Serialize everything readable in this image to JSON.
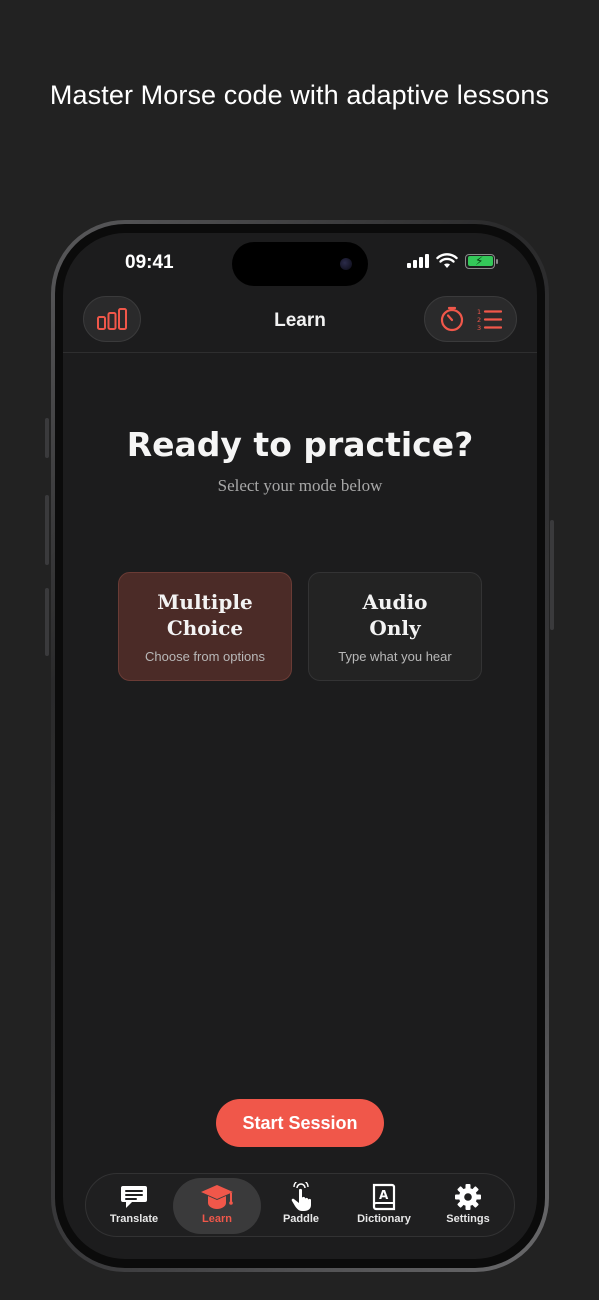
{
  "tagline": "Master Morse code with adaptive lessons",
  "status_bar": {
    "time": "09:41"
  },
  "header": {
    "title": "Learn"
  },
  "main": {
    "heading": "Ready to practice?",
    "subheading": "Select your mode below",
    "modes": [
      {
        "title_line1": "Multiple",
        "title_line2": "Choice",
        "description": "Choose from options",
        "selected": true
      },
      {
        "title_line1": "Audio",
        "title_line2": "Only",
        "description": "Type what you hear",
        "selected": false
      }
    ],
    "start_label": "Start Session"
  },
  "tabbar": {
    "items": [
      {
        "label": "Translate",
        "icon": "chat-bubble-icon"
      },
      {
        "label": "Learn",
        "icon": "graduation-cap-icon"
      },
      {
        "label": "Paddle",
        "icon": "tap-hand-icon"
      },
      {
        "label": "Dictionary",
        "icon": "book-icon"
      },
      {
        "label": "Settings",
        "icon": "gear-icon"
      }
    ],
    "active": "Learn"
  },
  "colors": {
    "accent": "#f0574a",
    "background": "#1c1c1d",
    "selected_card": "#4b2b27"
  }
}
